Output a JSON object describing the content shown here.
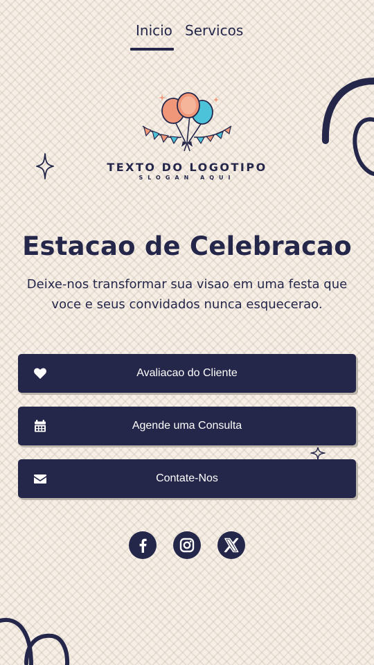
{
  "nav": {
    "tabs": [
      {
        "label": "Inicio"
      },
      {
        "label": "Servicos"
      }
    ]
  },
  "logo": {
    "title": "TEXTO DO LOGOTIPO",
    "slogan": "SLOGAN AQUI"
  },
  "hero": {
    "headline": "Estacao de Celebracao",
    "subtitle": "Deixe-nos transformar sua visao em uma festa que voce e seus convidados nunca esquecerao."
  },
  "buttons": [
    {
      "label": "Avaliacao do Cliente",
      "icon": "heart-icon"
    },
    {
      "label": "Agende uma Consulta",
      "icon": "calendar-icon"
    },
    {
      "label": "Contate-Nos",
      "icon": "envelope-icon"
    }
  ],
  "social": [
    {
      "icon": "facebook-icon"
    },
    {
      "icon": "instagram-icon"
    },
    {
      "icon": "x-twitter-icon"
    }
  ],
  "colors": {
    "background": "#f7efe6",
    "primary": "#24264a",
    "balloon_coral": "#f0977a",
    "balloon_teal": "#4cc3d9",
    "shadow": "#bdb6ad"
  }
}
